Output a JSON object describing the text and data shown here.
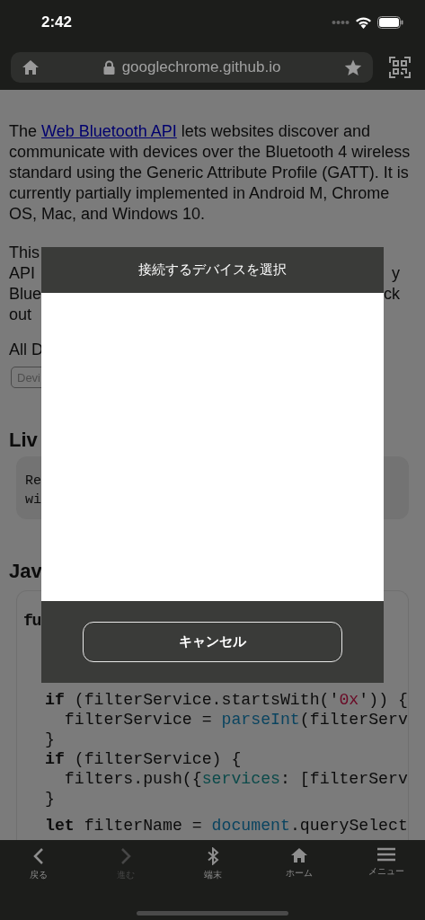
{
  "status_bar": {
    "time": "2:42"
  },
  "address_bar": {
    "url": "googlechrome.github.io"
  },
  "page": {
    "intro": {
      "before": "The ",
      "link": "Web Bluetooth API",
      "after": " lets websites discover and communicate with devices over the Bluetooth 4 wireless standard using the Generic Attribute Profile (GATT). It is currently partially implemented in Android M, Chrome OS, Mac, and Windows 10."
    },
    "partial_paragraph": [
      {
        "left": "This"
      },
      {
        "left": "API",
        "right": "y"
      },
      {
        "left": "Blue",
        "right": "ck"
      },
      {
        "left": "out"
      }
    ],
    "filter_label": "All D",
    "device_field": {
      "placeholder": "Devi"
    },
    "live_heading": "Liv",
    "live_output": [
      "Re",
      "wi"
    ],
    "js_heading": "Jav",
    "js_code": {
      "first_line": [
        {
          "text": "fu",
          "kind": "keyword"
        }
      ],
      "groups": [
        [
          [
            {
              "text": "if",
              "kind": "keyword"
            },
            {
              "text": " (filterService.startsWith('",
              "kind": "plain"
            },
            {
              "text": "0x",
              "kind": "string"
            },
            {
              "text": "')) {",
              "kind": "plain"
            }
          ],
          [
            {
              "text": "  filterService = ",
              "kind": "plain"
            },
            {
              "text": "parseInt",
              "kind": "builtin"
            },
            {
              "text": "(filterServ",
              "kind": "plain"
            }
          ],
          [
            {
              "text": "}",
              "kind": "plain"
            }
          ],
          [
            {
              "text": "if",
              "kind": "keyword"
            },
            {
              "text": " (filterService) {",
              "kind": "plain"
            }
          ],
          [
            {
              "text": "  filters.push({",
              "kind": "plain"
            },
            {
              "text": "services",
              "kind": "property"
            },
            {
              "text": ": [filterServ",
              "kind": "plain"
            }
          ],
          [
            {
              "text": "}",
              "kind": "plain"
            }
          ]
        ],
        [
          [
            {
              "text": "let",
              "kind": "keyword"
            },
            {
              "text": " filterName = ",
              "kind": "plain"
            },
            {
              "text": "document",
              "kind": "builtin"
            },
            {
              "text": ".querySelect",
              "kind": "plain"
            }
          ]
        ]
      ]
    }
  },
  "dialog": {
    "title": "接続するデバイスを選択",
    "cancel_button": "キャンセル"
  },
  "bottom_nav": [
    {
      "label": "戻る",
      "disabled": false
    },
    {
      "label": "進む",
      "disabled": true
    },
    {
      "label": "端末",
      "disabled": false
    },
    {
      "label": "ホーム",
      "disabled": false
    },
    {
      "label": "メニュー",
      "disabled": false
    }
  ]
}
